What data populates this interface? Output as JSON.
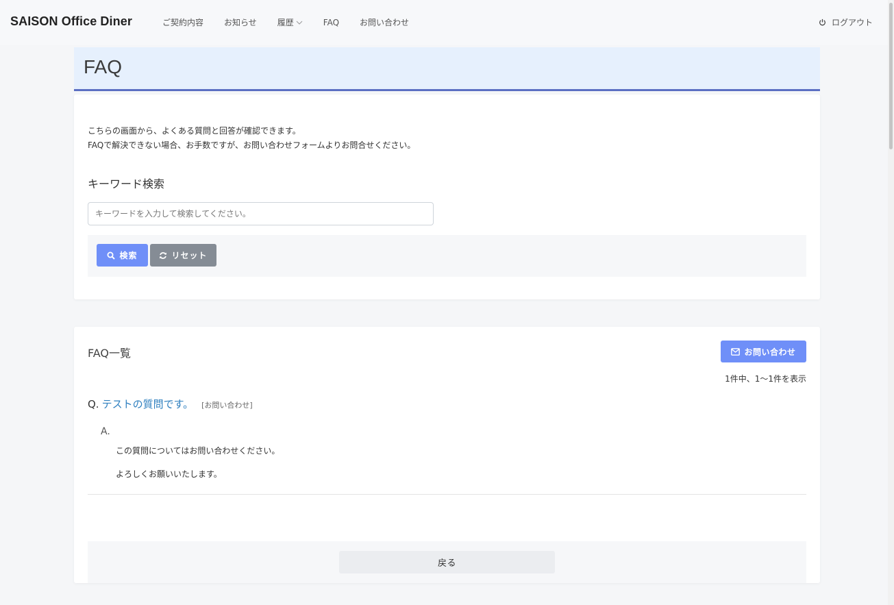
{
  "navbar": {
    "brand": "SAISON Office Diner",
    "items": [
      {
        "label": "ご契約内容"
      },
      {
        "label": "お知らせ"
      },
      {
        "label": "履歴"
      },
      {
        "label": "FAQ"
      },
      {
        "label": "お問い合わせ"
      }
    ],
    "logout_label": "ログアウト"
  },
  "header": {
    "title": "FAQ"
  },
  "search_card": {
    "intro_line1": "こちらの画面から、よくある質問と回答が確認できます。",
    "intro_line2": "FAQで解決できない場合、お手数ですが、お問い合わせフォームよりお問合せください。",
    "section_title": "キーワード検索",
    "search_placeholder": "キーワードを入力して検索してください。",
    "search_value": "",
    "search_button": "検索",
    "reset_button": "リセット"
  },
  "list_card": {
    "title": "FAQ一覧",
    "contact_button": "お問い合わせ",
    "count_text": "1件中、1〜1件を表示",
    "faq_items": [
      {
        "q_prefix": "Q.",
        "question": "テストの質問です。",
        "tag": "[お問い合わせ]",
        "a_prefix": "A.",
        "answer_line1": "この質問についてはお問い合わせください。",
        "answer_line2": "よろしくお願いいたします。"
      }
    ],
    "back_button": "戻る"
  },
  "colors": {
    "accent": "#6f8ff8",
    "secondary": "#858c95",
    "header_bg": "#e6f0fd",
    "header_border": "#5b6fc3",
    "question_link": "#2e7fbf"
  }
}
